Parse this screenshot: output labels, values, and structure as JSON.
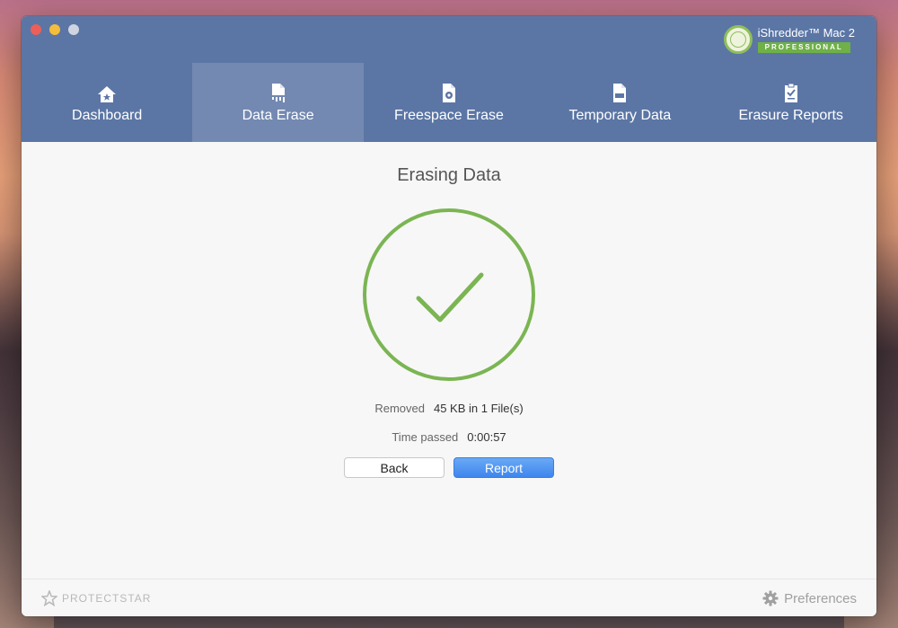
{
  "app": {
    "name": "iShredder™ Mac 2",
    "edition": "PROFESSIONAL"
  },
  "tabs": [
    {
      "label": "Dashboard",
      "icon": "house-icon"
    },
    {
      "label": "Data Erase",
      "icon": "shredded-file-icon"
    },
    {
      "label": "Freespace Erase",
      "icon": "file-gear-icon"
    },
    {
      "label": "Temporary Data",
      "icon": "tmp-file-icon"
    },
    {
      "label": "Erasure Reports",
      "icon": "clipboard-check-icon"
    }
  ],
  "active_tab": "Data Erase",
  "content": {
    "title": "Erasing Data",
    "status_icon": "checkmark-icon",
    "removed_label": "Removed",
    "removed_value": "45 KB in 1 File(s)",
    "time_label": "Time passed",
    "time_value": "0:00:57"
  },
  "buttons": {
    "back": "Back",
    "report": "Report"
  },
  "footer": {
    "logo_text": "PROTECTSTAR",
    "preferences": "Preferences"
  },
  "colors": {
    "header_blue": "#5b76a5",
    "active_tab": "#7389b2",
    "success_green": "#7bb553",
    "report_blue": "#3e86ee",
    "edition_green": "#6fb048"
  }
}
